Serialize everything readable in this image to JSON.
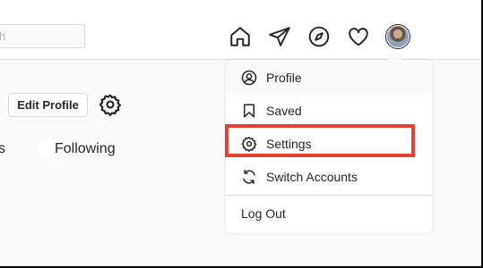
{
  "search": {
    "placeholder": "h"
  },
  "nav": {
    "icons": [
      "home-icon",
      "direct-messages-icon",
      "explore-compass-icon",
      "activity-heart-icon"
    ]
  },
  "profile": {
    "edit_profile_label": "Edit Profile",
    "stat_fragment": "s",
    "following_label": "Following"
  },
  "dropdown": {
    "items": [
      {
        "label": "Profile",
        "icon": "user-circle-icon"
      },
      {
        "label": "Saved",
        "icon": "bookmark-icon"
      },
      {
        "label": "Settings",
        "icon": "gear-icon"
      },
      {
        "label": "Switch Accounts",
        "icon": "switch-arrows-icon"
      }
    ],
    "logout_label": "Log Out"
  },
  "colors": {
    "highlight": "#e8412f",
    "text": "#262626",
    "border": "#dbdbdb"
  }
}
